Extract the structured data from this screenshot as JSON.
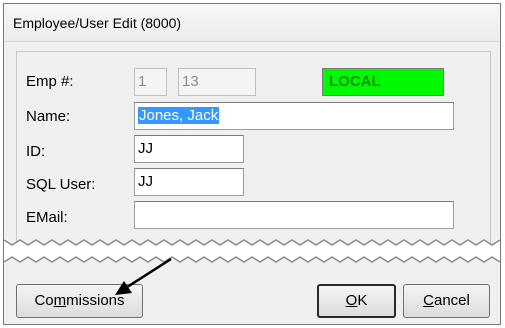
{
  "window": {
    "title": "Employee/User Edit (8000)"
  },
  "form": {
    "emp_label": "Emp #:",
    "emp_part1": "1",
    "emp_part2": "13",
    "location_badge": "LOCAL",
    "name_label": "Name:",
    "name_value": "Jones, Jack",
    "id_label": "ID:",
    "id_value": "JJ",
    "sql_label": "SQL User:",
    "sql_value": "JJ",
    "email_label": "EMail:",
    "email_value": ""
  },
  "buttons": {
    "commissions": {
      "pre": "Co",
      "accel": "m",
      "post": "missions"
    },
    "ok": {
      "accel": "O",
      "post": "K"
    },
    "cancel": {
      "accel": "C",
      "post": "ancel"
    }
  },
  "colors": {
    "local_badge_bg": "#00f900",
    "local_badge_text": "#009400",
    "selection": "#3399ff"
  }
}
